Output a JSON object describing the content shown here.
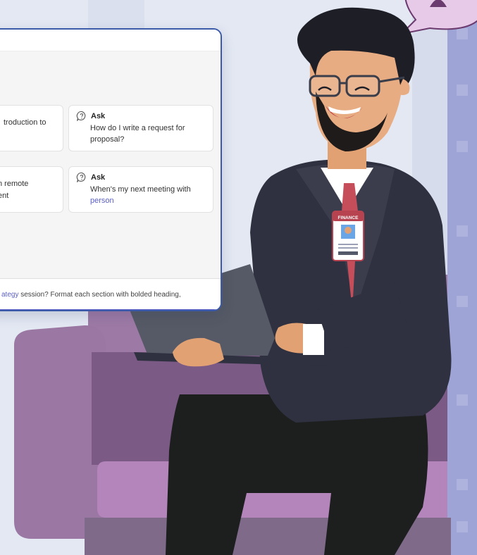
{
  "cards": [
    {
      "label": "",
      "text_line1": "troduction to",
      "text_line2": "",
      "link": ""
    },
    {
      "label": "Ask",
      "text_line1": "How do I write a request for",
      "text_line2": "proposal?",
      "link": ""
    },
    {
      "label": "",
      "text_line1": "n remote",
      "text_line2": "ent",
      "link": ""
    },
    {
      "label": "Ask",
      "text_line1": "When's my next meeting with",
      "text_line2": "",
      "link": "person"
    }
  ],
  "composer": {
    "link_text": "ategy",
    "text": " session? Format each section with bolded heading,"
  },
  "badge": {
    "text": "FINANCE"
  },
  "colors": {
    "panel_border": "#3b5aa8",
    "accent": "#5b5fc7",
    "background": "#e3e8f3",
    "sofa": "#9d7aa6",
    "jacket": "#2f3140"
  },
  "icons": [
    "ask-icon",
    "bell-icon"
  ]
}
